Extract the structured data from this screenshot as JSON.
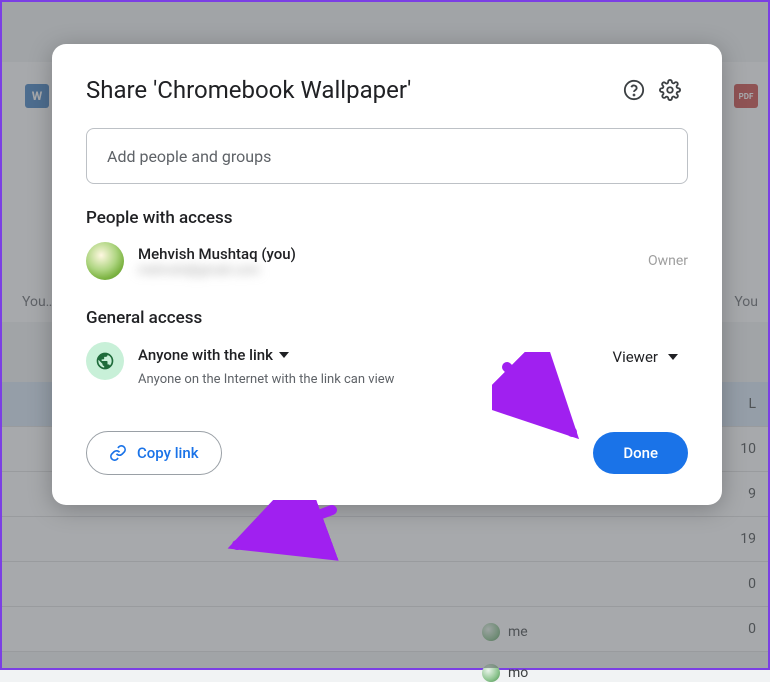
{
  "bg": {
    "you_left": "You…",
    "you_right": "You",
    "rows": [
      "L",
      "10",
      "9",
      "19",
      "0",
      "0"
    ],
    "me_label": "me",
    "me_label2": "mo"
  },
  "modal": {
    "title": "Share 'Chromebook Wallpaper'",
    "input_placeholder": "Add people and groups",
    "people_section": "People with access",
    "person_name": "Mehvish Mushtaq (you)",
    "person_email": "mehvish@gmail.com",
    "owner_role": "Owner",
    "general_section": "General access",
    "access_type": "Anyone with the link",
    "access_desc": "Anyone on the Internet with the link can view",
    "role": "Viewer",
    "copy_link": "Copy link",
    "done": "Done"
  },
  "colors": {
    "primary": "#1a73e8",
    "arrow": "#a020f0"
  }
}
